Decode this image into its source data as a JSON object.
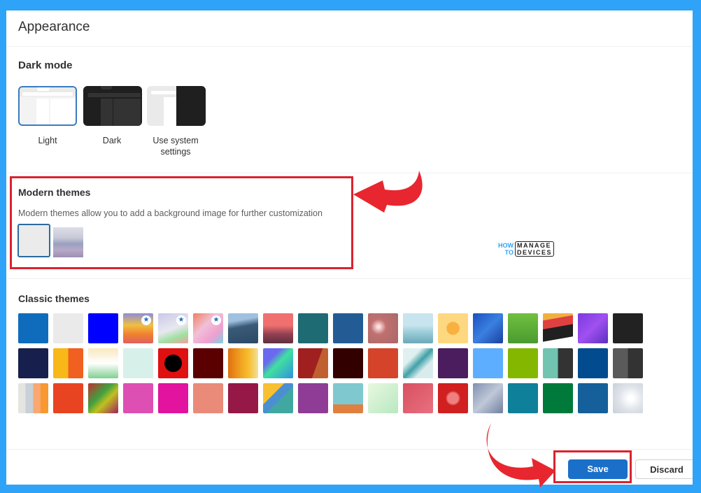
{
  "page": {
    "title": "Appearance"
  },
  "dark_mode": {
    "heading": "Dark mode",
    "options": [
      {
        "label": "Light",
        "selected": true
      },
      {
        "label": "Dark",
        "selected": false
      },
      {
        "label": "Use system settings",
        "selected": false
      }
    ]
  },
  "modern_themes": {
    "heading": "Modern themes",
    "description": "Modern themes allow you to add a background image for further customization",
    "items": [
      {
        "name": "default-light",
        "selected": true
      },
      {
        "name": "misty-hills",
        "selected": false
      }
    ]
  },
  "classic_themes": {
    "heading": "Classic themes",
    "rows": [
      [
        {
          "name": "blue",
          "bg": "#0f6cbd"
        },
        {
          "name": "light-gray",
          "bg": "#eaeaea"
        },
        {
          "name": "bright-blue",
          "bg": "#0000ff"
        },
        {
          "name": "rainbow-stripes",
          "bg": "linear-gradient(180deg,#8e8ed8,#f0c040 40%,#f08030 70%,#e06060)",
          "featured": true
        },
        {
          "name": "pastel-swirl",
          "bg": "linear-gradient(160deg,#c8c8e8,#e8e8f0 50%,#a0e0a0 75%,#f0a0a0)",
          "featured": true
        },
        {
          "name": "unicorn",
          "bg": "linear-gradient(135deg,#f08060,#f0c0d8 40%,#f0a0d0 70%,#80d0e0)",
          "featured": true
        },
        {
          "name": "mountain",
          "bg": "linear-gradient(170deg,#a0c0e0 25%,#3a5a78 45%,#2a4a68)"
        },
        {
          "name": "palm-sunset",
          "bg": "linear-gradient(180deg,#f07070 40%,#904050 70%,#603040)"
        },
        {
          "name": "circuit",
          "bg": "#1f6b74"
        },
        {
          "name": "innovation",
          "bg": "#235c94"
        },
        {
          "name": "bokeh",
          "bg": "radial-gradient(circle at 35% 45%,#ffe0e0 5%,#c07070 30%,#a86868)"
        },
        {
          "name": "ocean-boat",
          "bg": "linear-gradient(180deg,#c8e4ee 40%,#a0d0dc 60%,#6aa8b8)"
        },
        {
          "name": "star",
          "bg": "radial-gradient(circle at 50% 50%,#f8b040 30%,#fdd880 31%)"
        },
        {
          "name": "blue-abstract",
          "bg": "linear-gradient(135deg,#1a50c0,#3a80e0 50%,#1a40a0)"
        },
        {
          "name": "green-meadow",
          "bg": "linear-gradient(180deg,#70c040,#4a9a30)"
        },
        {
          "name": "red-black-geo",
          "bg": "linear-gradient(170deg,#f0b040 20%,#e04040 21%,#e04040 45%,#202020 46%,#202020 80%,#fff 81%)"
        },
        {
          "name": "purple-haze",
          "bg": "linear-gradient(135deg,#7a3ae0,#a050f0 50%,#5a30c0)"
        },
        {
          "name": "charcoal",
          "bg": "#222222"
        }
      ],
      [
        {
          "name": "navy",
          "bg": "#17204d"
        },
        {
          "name": "lego",
          "bg": "linear-gradient(90deg,#f8b818 50%,#f06020 50%)"
        },
        {
          "name": "lucky-cat",
          "bg": "linear-gradient(180deg,#f8e8c0,#ffffff 50%,#80d090)"
        },
        {
          "name": "mint-chevron",
          "bg": "#d8f0ea"
        },
        {
          "name": "red-black-dots",
          "bg": "radial-gradient(circle,#000 40%,#e01010 42%)"
        },
        {
          "name": "maroon",
          "bg": "#5a0000"
        },
        {
          "name": "crayons",
          "bg": "linear-gradient(90deg,#e07010,#f0a020 40%,#f8c030 70%,#f0e0a0)"
        },
        {
          "name": "blocks",
          "bg": "linear-gradient(135deg,#6a6af0 30%,#40e0a0 50%,#3090e0)"
        },
        {
          "name": "red-wood",
          "bg": "linear-gradient(110deg,#a02020 60%,#c06030 61%)"
        },
        {
          "name": "dark-maroon",
          "bg": "#330000"
        },
        {
          "name": "orange-red",
          "bg": "#d5432a"
        },
        {
          "name": "hexagons",
          "bg": "linear-gradient(135deg,#e0f0f0 30%,#40a0a8 50%,#d8ecee 70%)"
        },
        {
          "name": "purple",
          "bg": "#4b1d5e"
        },
        {
          "name": "sky-blue",
          "bg": "#5eaeff"
        },
        {
          "name": "lime",
          "bg": "#84b800"
        },
        {
          "name": "teal-dark-split",
          "bg": "linear-gradient(90deg,#70c4b0 50%,#333 50%)"
        },
        {
          "name": "deep-blue",
          "bg": "#024b8e"
        },
        {
          "name": "gray-split",
          "bg": "linear-gradient(90deg,#5a5a5a 50%,#333 50%)"
        }
      ],
      [
        {
          "name": "pastel-stripes",
          "bg": "linear-gradient(90deg,#e4e4e0 25%,#c8d0d8 25%,#c8d0d8 50%,#f8a870 50%,#f8a870 75%,#f89830 75%)"
        },
        {
          "name": "vermilion",
          "bg": "#e84422"
        },
        {
          "name": "paint-splash",
          "bg": "linear-gradient(135deg,#c03030,#40a040 40%,#c0c020 60%,#a02060)"
        },
        {
          "name": "pink",
          "bg": "#de4fb4"
        },
        {
          "name": "magenta",
          "bg": "#e2139f"
        },
        {
          "name": "salmon-dots",
          "bg": "#e98b78"
        },
        {
          "name": "crimson",
          "bg": "#961846"
        },
        {
          "name": "material",
          "bg": "linear-gradient(135deg,#f8c030 35%,#4a90d0 36%,#4a90d0 55%,#40a8a0 56%)"
        },
        {
          "name": "violet",
          "bg": "#8f3c96"
        },
        {
          "name": "robot",
          "bg": "linear-gradient(180deg,#80c8d0 70%,#e08040 71%)"
        },
        {
          "name": "mint-geo",
          "bg": "linear-gradient(135deg,#e8f8e0,#b8e8c0)"
        },
        {
          "name": "coral-geo",
          "bg": "linear-gradient(135deg,#d85060,#e87080)"
        },
        {
          "name": "red-knit",
          "bg": "radial-gradient(circle,#f08080 25%,#d02020 35%)"
        },
        {
          "name": "denim-heart",
          "bg": "linear-gradient(135deg,#8090b0,#c0c8d8 50%,#7080a0)"
        },
        {
          "name": "teal",
          "bg": "#0f8099"
        },
        {
          "name": "green",
          "bg": "#007a3a"
        },
        {
          "name": "blue-circles",
          "bg": "#15609a"
        },
        {
          "name": "snowflakes",
          "bg": "radial-gradient(circle at 60% 50%,#ffffff 10%,#e0e4ea 50%,#c8d0d8)"
        }
      ]
    ]
  },
  "footer": {
    "save_label": "Save",
    "discard_label": "Discard"
  },
  "watermark": {
    "line1_left": "HOW",
    "line2_left": "TO",
    "line1_right": "MANAGE",
    "line2_right": "DEVICES"
  },
  "colors": {
    "accent": "#1a6fc9",
    "annotation_red": "#d9232e",
    "frame_blue": "#2ea3f7"
  }
}
